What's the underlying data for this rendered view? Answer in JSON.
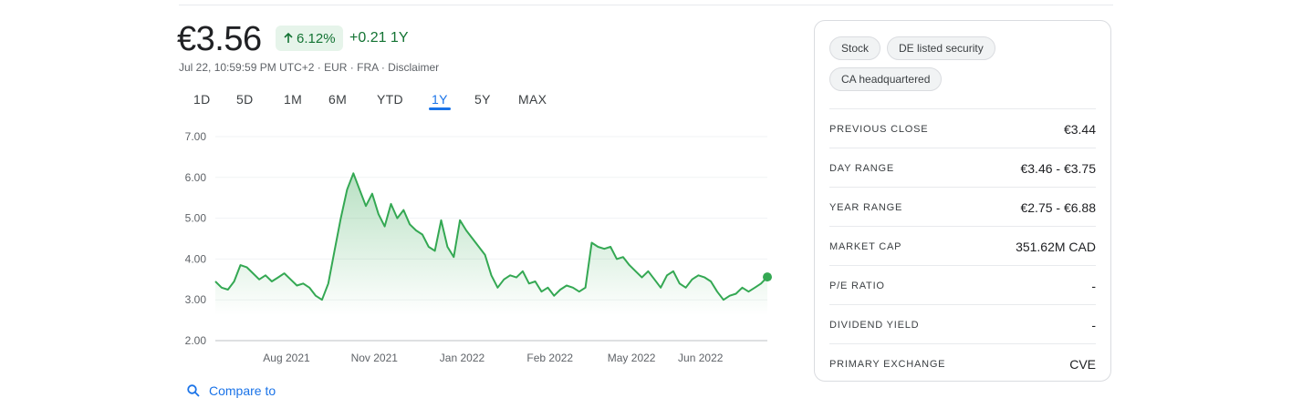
{
  "quote": {
    "price": "€3.56",
    "change_pct": "6.12%",
    "change_abs": "+0.21 1Y",
    "timestamp": "Jul 22, 10:59:59 PM UTC+2",
    "currency": "EUR",
    "exchange": "FRA",
    "disclaimer": "Disclaimer",
    "up_color": "#137333"
  },
  "ranges": [
    {
      "label": "1D",
      "active": false
    },
    {
      "label": "5D",
      "active": false
    },
    {
      "label": "1M",
      "active": false
    },
    {
      "label": "6M",
      "active": false
    },
    {
      "label": "YTD",
      "active": false
    },
    {
      "label": "1Y",
      "active": true
    },
    {
      "label": "5Y",
      "active": false
    },
    {
      "label": "MAX",
      "active": false
    }
  ],
  "compare_label": "Compare to",
  "chips": [
    "Stock",
    "DE listed security",
    "CA headquartered"
  ],
  "stats": [
    {
      "label": "PREVIOUS CLOSE",
      "value": "€3.44"
    },
    {
      "label": "DAY RANGE",
      "value": "€3.46 - €3.75"
    },
    {
      "label": "YEAR RANGE",
      "value": "€2.75 - €6.88"
    },
    {
      "label": "MARKET CAP",
      "value": "351.62M CAD"
    },
    {
      "label": "P/E RATIO",
      "value": "-"
    },
    {
      "label": "DIVIDEND YIELD",
      "value": "-"
    },
    {
      "label": "PRIMARY EXCHANGE",
      "value": "CVE"
    }
  ],
  "chart_data": {
    "type": "area",
    "ylim": [
      2.0,
      7.0
    ],
    "yticks": [
      "7.00",
      "6.00",
      "5.00",
      "4.00",
      "3.00",
      "2.00"
    ],
    "xticks": [
      "Aug 2021",
      "Nov 2021",
      "Jan 2022",
      "Feb 2022",
      "May 2022",
      "Jun 2022"
    ],
    "line_color": "#34a853",
    "values": [
      3.45,
      3.3,
      3.25,
      3.45,
      3.85,
      3.8,
      3.65,
      3.5,
      3.6,
      3.45,
      3.55,
      3.65,
      3.5,
      3.35,
      3.4,
      3.3,
      3.1,
      3.0,
      3.4,
      4.2,
      5.0,
      5.7,
      6.1,
      5.7,
      5.3,
      5.6,
      5.1,
      4.8,
      5.35,
      5.0,
      5.2,
      4.85,
      4.7,
      4.6,
      4.3,
      4.2,
      4.95,
      4.3,
      4.05,
      4.95,
      4.7,
      4.5,
      4.3,
      4.1,
      3.6,
      3.3,
      3.5,
      3.6,
      3.55,
      3.7,
      3.4,
      3.45,
      3.2,
      3.3,
      3.1,
      3.25,
      3.35,
      3.3,
      3.2,
      3.3,
      4.4,
      4.3,
      4.25,
      4.3,
      4.0,
      4.05,
      3.85,
      3.7,
      3.55,
      3.7,
      3.5,
      3.3,
      3.6,
      3.7,
      3.4,
      3.3,
      3.5,
      3.6,
      3.55,
      3.45,
      3.2,
      3.0,
      3.1,
      3.15,
      3.3,
      3.2,
      3.3,
      3.4,
      3.56
    ]
  }
}
